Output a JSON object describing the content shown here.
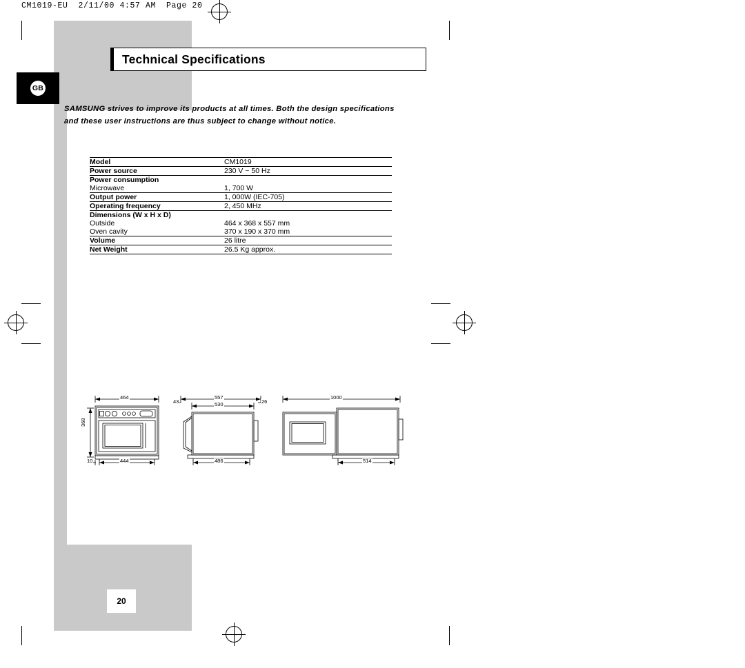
{
  "print_slug": "CM1019-EU  2/11/00 4:57 AM  Page 20",
  "language_tab": "GB",
  "page_number": "20",
  "title": "Technical Specifications",
  "intro": "SAMSUNG strives to improve its products at all times. Both the design specifications and these user instructions are thus subject to change without notice.",
  "spec_table": {
    "rows": [
      {
        "label": "Model",
        "bold": true,
        "indent": false,
        "value": "CM1019"
      },
      {
        "label": "Power source",
        "bold": true,
        "indent": false,
        "value": "230 V ~ 50 Hz"
      },
      {
        "label": "Power consumption",
        "bold": true,
        "indent": false,
        "value": ""
      },
      {
        "label": "Microwave",
        "bold": false,
        "indent": true,
        "value": "1, 700 W"
      },
      {
        "label": "Output power",
        "bold": true,
        "indent": false,
        "value": "1, 000W (IEC-705)"
      },
      {
        "label": "Operating frequency",
        "bold": true,
        "indent": false,
        "value": "2, 450 MHz"
      },
      {
        "label": "Dimensions (W x H x D)",
        "bold": true,
        "indent": false,
        "value": ""
      },
      {
        "label": "Outside",
        "bold": false,
        "indent": true,
        "value": "464 x 368 x 557 mm"
      },
      {
        "label": "Oven cavity",
        "bold": false,
        "indent": true,
        "value": "370 x 190 x 370 mm"
      },
      {
        "label": "Volume",
        "bold": true,
        "indent": false,
        "value": "26 litre"
      },
      {
        "label": "Net Weight",
        "bold": true,
        "indent": false,
        "value": "26.5 Kg approx."
      }
    ]
  },
  "drawings": {
    "front_view": {
      "width": "464",
      "height": "368",
      "base_width": "444",
      "foot": "10"
    },
    "side_view": {
      "depth": "557",
      "body_depth": "530",
      "front_offset": "43",
      "rear_offset": "26",
      "base_depth": "486"
    },
    "open_door_view": {
      "total": "1000",
      "base": "514"
    }
  }
}
